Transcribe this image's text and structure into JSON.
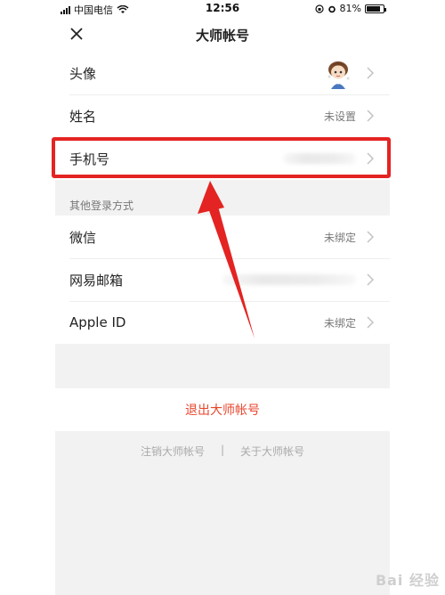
{
  "status_bar": {
    "carrier": "中国电信",
    "time": "12:56",
    "battery_percent": "81%",
    "battery_level": 0.81
  },
  "nav": {
    "title": "大师帐号",
    "close_icon": "close-icon"
  },
  "profile": {
    "avatar_label": "头像",
    "name_label": "姓名",
    "name_value": "未设置",
    "phone_label": "手机号"
  },
  "other_login": {
    "section_title": "其他登录方式",
    "items": [
      {
        "label": "微信",
        "value": "未绑定"
      },
      {
        "label": "网易邮箱",
        "value": ""
      },
      {
        "label": "Apple ID",
        "value": "未绑定"
      }
    ]
  },
  "logout_label": "退出大师帐号",
  "footer": {
    "cancel_label": "注销大师帐号",
    "separator": "|",
    "about_label": "关于大师帐号"
  },
  "colors": {
    "highlight": "#e32422",
    "logout_text": "#e8452c"
  },
  "watermark": "Bai 经验"
}
